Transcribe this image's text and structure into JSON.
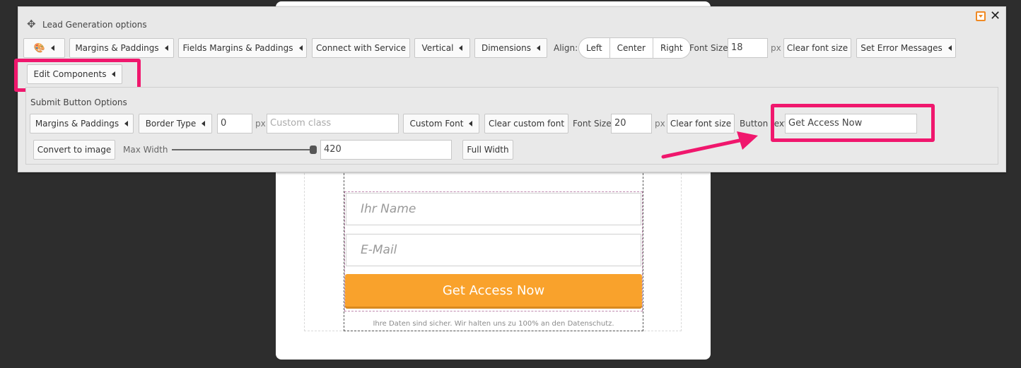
{
  "form": {
    "name_placeholder": "Ihr Name",
    "email_placeholder": "E-Mail",
    "submit_label": "Get Access Now",
    "privacy_text": "Ihre Daten sind sicher. Wir halten uns zu 100% an den Datenschutz."
  },
  "panel": {
    "title": "Lead Generation options",
    "row1": {
      "margins_paddings": "Margins & Paddings",
      "fields_margins_paddings": "Fields Margins & Paddings",
      "connect_service": "Connect with Service",
      "vertical": "Vertical",
      "dimensions": "Dimensions",
      "align_label": "Align:",
      "align_left": "Left",
      "align_center": "Center",
      "align_right": "Right",
      "font_size_label": "Font Size",
      "font_size_value": "18",
      "px": "px",
      "clear_font_size": "Clear font size",
      "set_error_messages": "Set Error Messages"
    },
    "edit_components": "Edit Components",
    "submit_options": {
      "title": "Submit Button Options",
      "margins_paddings": "Margins & Paddings",
      "border_type": "Border Type",
      "border_value": "0",
      "px": "px",
      "custom_class_placeholder": "Custom class",
      "custom_font": "Custom Font",
      "clear_custom_font": "Clear custom font",
      "font_size_label": "Font Size",
      "font_size_value": "20",
      "clear_font_size": "Clear font size",
      "button_text_label": "Button text",
      "button_text_value": "Get Access Now",
      "convert_to_image": "Convert to image",
      "max_width_label": "Max Width",
      "max_width_value": "420",
      "full_width": "Full Width"
    }
  },
  "colors": {
    "submit": "#f9a22c",
    "highlight": "#f0176d",
    "accent_minimize": "#f08a24"
  }
}
